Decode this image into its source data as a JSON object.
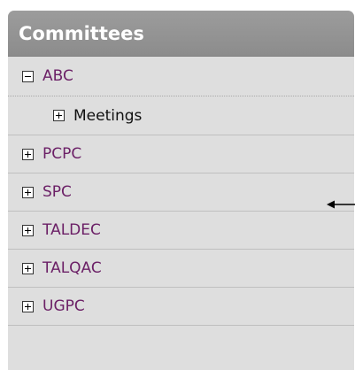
{
  "panel": {
    "title": "Committees"
  },
  "tree": {
    "items": [
      {
        "label": "ABC",
        "state": "collapse",
        "icon": "minus-box-icon"
      },
      {
        "label": "Meetings",
        "state": "expand",
        "icon": "plus-box-icon"
      },
      {
        "label": "PCPC",
        "state": "expand",
        "icon": "plus-box-icon"
      },
      {
        "label": "SPC",
        "state": "expand",
        "icon": "plus-box-icon"
      },
      {
        "label": "TALDEC",
        "state": "expand",
        "icon": "plus-box-icon"
      },
      {
        "label": "TALQAC",
        "state": "expand",
        "icon": "plus-box-icon"
      },
      {
        "label": "UGPC",
        "state": "expand",
        "icon": "plus-box-icon"
      }
    ]
  },
  "colors": {
    "header_bg": "#959595",
    "panel_bg": "#dedede",
    "item_text": "#6b1f66",
    "sub_item_text": "#111111"
  },
  "annotation": {
    "icon": "left-arrow-icon"
  }
}
